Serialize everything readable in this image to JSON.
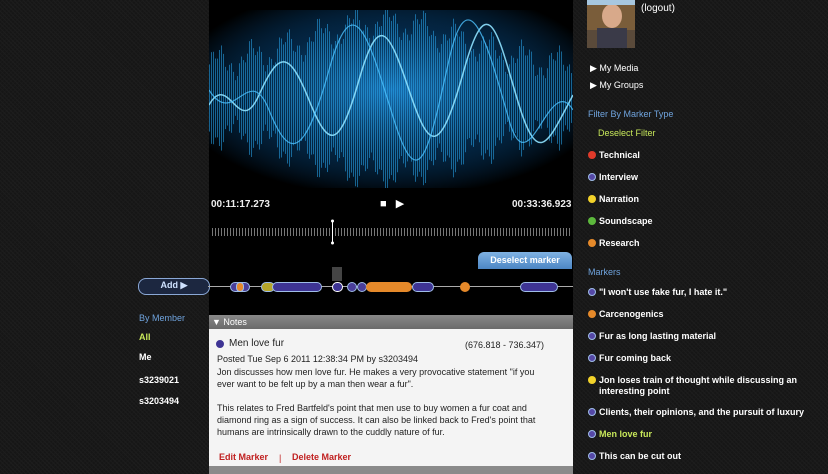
{
  "player": {
    "current_time": "00:11:17.273",
    "duration": "00:33:36.923",
    "stop_symbol": "■",
    "play_symbol": "▶",
    "deselect_marker_label": "Deselect marker",
    "add_label": "Add ▶"
  },
  "members": {
    "heading": "By Member",
    "items": [
      "All",
      "Me",
      "s3239021",
      "s3203494"
    ]
  },
  "notes": {
    "bar_label": "▼ Notes",
    "title": "Men love fur",
    "range": "(676.818 - 736.347)",
    "posted": "Posted Tue Sep 6 2011 12:38:34 PM by s3203494",
    "para1_line1": "Jon discusses how men love fur. He makes a very provocative statement \"if you",
    "para1_line2": "ever want to be felt up by a man then wear a fur\".",
    "para2_line1": "This relates to Fred Bartfeld's point that men use to buy women a fur coat and",
    "para2_line2": "diamond ring as a sign of success. It can also be linked back to Fred's point that",
    "para2_line3": "humans are intrinsically drawn to the cuddly nature of fur.",
    "edit_label": "Edit Marker",
    "separator": "|",
    "delete_label": "Delete Marker"
  },
  "user": {
    "logout": "(logout)",
    "nav": [
      "▶ My Media",
      "▶ My Groups"
    ]
  },
  "filter": {
    "heading": "Filter By Marker Type",
    "deselect": "Deselect Filter",
    "types": [
      {
        "label": "Technical",
        "color": "#e03a2a"
      },
      {
        "label": "Interview",
        "color": "#5548a6"
      },
      {
        "label": "Narration",
        "color": "#f2d22a"
      },
      {
        "label": "Soundscape",
        "color": "#5cb83c"
      },
      {
        "label": "Research",
        "color": "#e5892a"
      }
    ]
  },
  "markers": {
    "heading": "Markers",
    "items": [
      {
        "label": "\"I won't use fake fur, I hate it.\"",
        "color": "#5548a6"
      },
      {
        "label": "Carcenogenics",
        "color": "#e5892a"
      },
      {
        "label": "Fur as long lasting material",
        "color": "#5548a6"
      },
      {
        "label": "Fur coming back",
        "color": "#5548a6"
      },
      {
        "label": "Jon loses train of thought while discussing an",
        "label2": "interesting point",
        "color": "#f2d22a"
      },
      {
        "label": "Clients, their opinions, and the pursuit of luxury",
        "color": "#5548a6"
      },
      {
        "label": "Men love fur",
        "color": "#5548a6",
        "selected": true
      },
      {
        "label": "This can be cut out",
        "color": "#5548a6"
      }
    ]
  },
  "colors": {
    "accent_blue": "#6fa3dd",
    "selected_green": "#c8e85a",
    "link_red": "#c02020"
  }
}
